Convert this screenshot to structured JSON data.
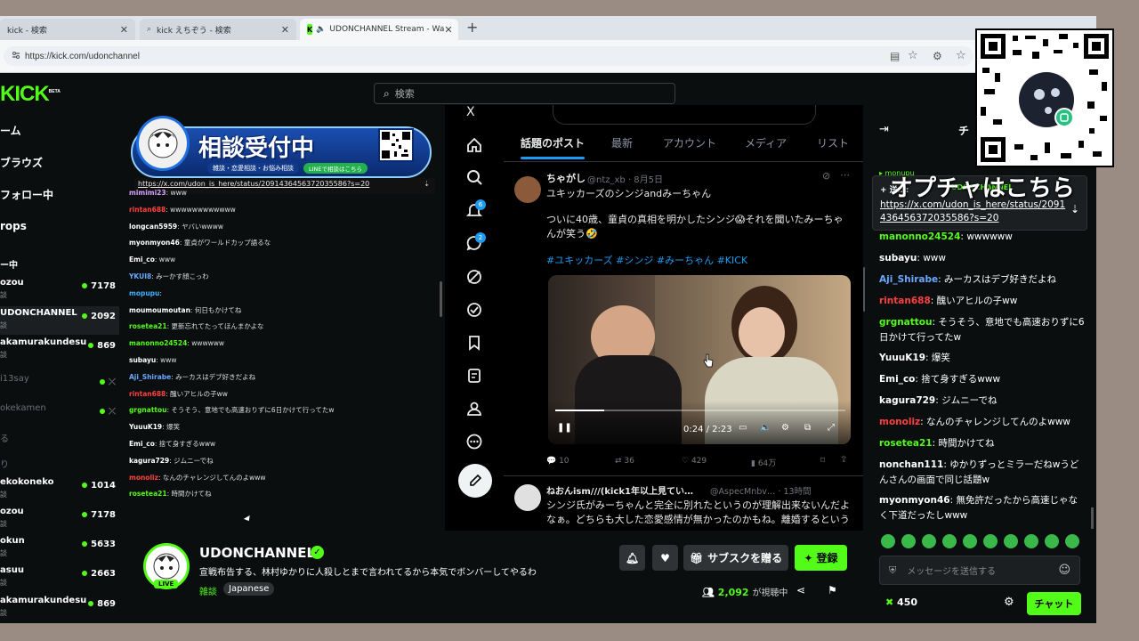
{
  "browser": {
    "tabs": [
      {
        "label": "kick - 検索"
      },
      {
        "label": "kick えちぞう - 検索"
      },
      {
        "label": "UDONCHANNEL Stream - Wa"
      }
    ],
    "url": "https://kick.com/udonchannel"
  },
  "header": {
    "logo": "KICK",
    "logo_badge": "BETA",
    "search_placeholder": "検索"
  },
  "sidebar": {
    "nav": [
      "ーム",
      "ブラウズ",
      "フォロー中",
      "rops"
    ],
    "section_title": "ー中",
    "channels": [
      {
        "name": "ozou",
        "sub": "談",
        "viewers": "7178"
      },
      {
        "name": "UDONCHANNEL",
        "sub": "談",
        "viewers": "2092"
      },
      {
        "name": "akamurakundesu",
        "sub": "談",
        "viewers": "869"
      },
      {
        "name": "i13say",
        "sub": "",
        "viewers": ""
      },
      {
        "name": "okekamen",
        "sub": "",
        "viewers": ""
      },
      {
        "name": "る",
        "sub": "",
        "viewers": ""
      },
      {
        "name": "り",
        "sub": "",
        "viewers": ""
      },
      {
        "name": "ekokoneko",
        "sub": "談",
        "viewers": "1014"
      },
      {
        "name": "ozou",
        "sub": "談",
        "viewers": "7178"
      },
      {
        "name": "okun",
        "sub": "談",
        "viewers": "5633"
      },
      {
        "name": "asuu",
        "sub": "談",
        "viewers": "2663"
      },
      {
        "name": "akamurakundesu",
        "sub": "談",
        "viewers": "869"
      }
    ]
  },
  "stream_banner": {
    "title": "相談受付中",
    "subtitle": "雑談・恋愛相談・お悩み相談",
    "line": "LINEで相談はこちら",
    "link": "https://x.com/udon_is_here/status/2091436456372035586?s=20"
  },
  "video_chat": [
    {
      "user": "mimimi23",
      "msg": "www",
      "color": "#d0a0ff"
    },
    {
      "user": "rintan688",
      "msg": "wwwwwwwwwwww",
      "color": "#ff4040"
    },
    {
      "user": "longcan5959",
      "msg": "ヤバいwwww",
      "color": "#ffffff"
    },
    {
      "user": "myonmyon46",
      "msg": "童貞がワールドカップ語るな",
      "color": "#ffffff"
    },
    {
      "user": "Emi_co",
      "msg": "www",
      "color": "#ffffff"
    },
    {
      "user": "YKUI8",
      "msg": "みーかす顔こっわ",
      "color": "#6aa8ff"
    },
    {
      "user": "mopupu",
      "msg": "",
      "color": "#3db0ff"
    },
    {
      "user": "moumoumoutan",
      "msg": "何日もかけてね",
      "color": "#ffffff"
    },
    {
      "user": "rosetea21",
      "msg": "更新忘れてたってほんまかよな",
      "color": "#53fc18"
    },
    {
      "user": "manonno24524",
      "msg": "wwwwww",
      "color": "#53fc18"
    },
    {
      "user": "subayu",
      "msg": "www",
      "color": "#ffffff"
    },
    {
      "user": "Aji_Shirabe",
      "msg": "みーカスはデブ好きだよね",
      "color": "#6aa8ff"
    },
    {
      "user": "rintan688",
      "msg": "醜いアヒルの子ww",
      "color": "#ff4040"
    },
    {
      "user": "grgnattou",
      "msg": "そうそう、意地でも高速おりずに6日かけて行ってたw",
      "color": "#53fc18"
    },
    {
      "user": "YuuuK19",
      "msg": "爆笑",
      "color": "#ffffff"
    },
    {
      "user": "Emi_co",
      "msg": "捨て身すぎるwww",
      "color": "#ffffff"
    },
    {
      "user": "kagura729",
      "msg": "ジムニーでね",
      "color": "#ffffff"
    },
    {
      "user": "monoliz",
      "msg": "なんのチャレンジしてんのよwww",
      "color": "#ff4040"
    },
    {
      "user": "rosetea21",
      "msg": "時間かけてね",
      "color": "#53fc18"
    }
  ],
  "x_app": {
    "tabs": [
      "話題のポスト",
      "最新",
      "アカウント",
      "メディア",
      "リスト"
    ],
    "badges": [
      "6",
      "2"
    ],
    "post": {
      "author": "ちゃがし",
      "handle": "@ntz_xb · 8月5日",
      "title": "ユキッカーズのシンジandみーちゃん",
      "body": "ついに40歳、童貞の真相を明かしたシンジ😱それを聞いたみーちゃんが笑う🤣",
      "tags": "#ユキッカーズ #シンジ #みーちゃん #KICK",
      "time": "0:24 / 2:23",
      "replies": "10",
      "reposts": "36",
      "likes": "429",
      "views": "64万"
    },
    "post2": {
      "author": "ねおんism///(kick1年以上見てい…",
      "handle": "@AspecMnbv… · 13時間",
      "body": "シンジ氏がみーちゃんと完全に別れたというのが理解出来ないんだよなぁ。どちらも大した恋愛感情が無かったのかもね。離婚するという"
    }
  },
  "channel": {
    "name": "UDONCHANNEL",
    "title": "宣戦布告する、林村ゆかりに人殺しとまで言われてるから本気でボンバーしてやるわ",
    "category": "雑談",
    "language": "Japanese",
    "live_badge": "LIVE",
    "gift_label": "サブスクを贈る",
    "follow_label": "登録",
    "viewer_count": "2,092",
    "viewer_suffix": "が視聴中"
  },
  "chat": {
    "header": "チ",
    "pinned": {
      "label": "+ 送…:",
      "user": "UDONCHANNEL",
      "link": "https://x.com/udon_is_here/status/2091436456372035586?s=20"
    },
    "overlay_text": "オプチャはこちら",
    "messages": [
      {
        "user": "manonno24524",
        "msg": "wwwwww",
        "color": "#53fc18"
      },
      {
        "user": "subayu",
        "msg": "www",
        "color": "#ffffff"
      },
      {
        "user": "Aji_Shirabe",
        "msg": "みーカスはデブ好きだよね",
        "color": "#6aa8ff"
      },
      {
        "user": "rintan688",
        "msg": "醜いアヒルの子ww",
        "color": "#ff4040"
      },
      {
        "user": "grgnattou",
        "msg": "そうそう、意地でも高速おりずに6日かけて行ってたw",
        "color": "#53fc18"
      },
      {
        "user": "YuuuK19",
        "msg": "爆笑",
        "color": "#ffffff"
      },
      {
        "user": "Emi_co",
        "msg": "捨て身すぎるwww",
        "color": "#ffffff"
      },
      {
        "user": "kagura729",
        "msg": "ジムニーでね",
        "color": "#ffffff"
      },
      {
        "user": "monoliz",
        "msg": "なんのチャレンジしてんのよwww",
        "color": "#ff4040"
      },
      {
        "user": "rosetea21",
        "msg": "時間かけてね",
        "color": "#53fc18"
      },
      {
        "user": "nonchan111",
        "msg": "ゆかりずっとミラーだねwうどんさんの画面で同じ話題w",
        "color": "#ffffff"
      },
      {
        "user": "myonmyon46",
        "msg": "無免許だったから高速じゃなく下道だったしwww",
        "color": "#ffffff"
      }
    ],
    "input_placeholder": "メッセージを送信する",
    "points": "450",
    "send_label": "チャット"
  },
  "colors": {
    "accent": "#53fc18",
    "bg": "#0b0e0f"
  }
}
